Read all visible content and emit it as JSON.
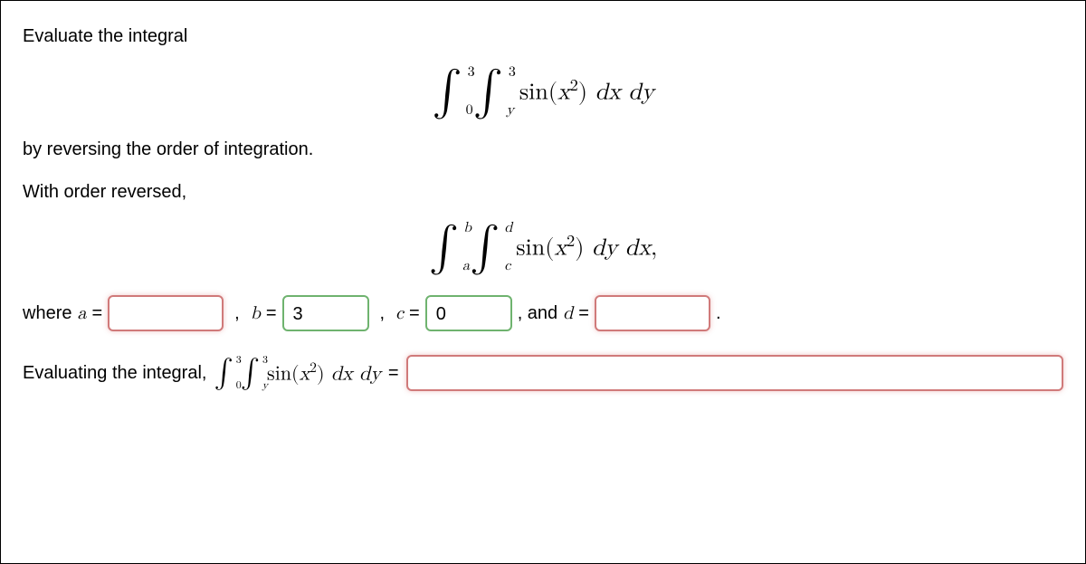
{
  "intro": "Evaluate the integral",
  "integral1": {
    "outer_lower": "0",
    "outer_upper": "3",
    "inner_lower": "y",
    "inner_upper": "3",
    "integrand_prefix": "sin(",
    "integrand_var": "x",
    "integrand_squared": "2",
    "integrand_suffix": ") ",
    "dvar1": "dx",
    "dvar2": "dy"
  },
  "mid_text": "by reversing the order of integration.",
  "reversed_text": "With order reversed,",
  "integral2": {
    "outer_lower": "a",
    "outer_upper": "b",
    "inner_lower": "c",
    "inner_upper": "d",
    "integrand_prefix": "sin(",
    "integrand_var": "x",
    "integrand_squared": "2",
    "integrand_suffix": ") ",
    "dvar1": "dy",
    "dvar2": "dx",
    "trailing": ","
  },
  "answers": {
    "where": "where ",
    "a_label": "a",
    "eq": " = ",
    "a_value": "",
    "b_label": "b",
    "b_value": "3",
    "c_label": "c",
    "c_value": "0",
    "and": ", and ",
    "d_label": "d",
    "d_value": "",
    "period": "."
  },
  "eval": {
    "prefix": "Evaluating the integral, ",
    "outer_lower": "0",
    "outer_upper": "3",
    "inner_lower": "y",
    "inner_upper": "3",
    "integrand_prefix": "sin(",
    "integrand_var": "x",
    "integrand_squared": "2",
    "integrand_suffix": ") ",
    "dvar1": "dx",
    "dvar2": "dy",
    "equals": " = ",
    "value": ""
  }
}
